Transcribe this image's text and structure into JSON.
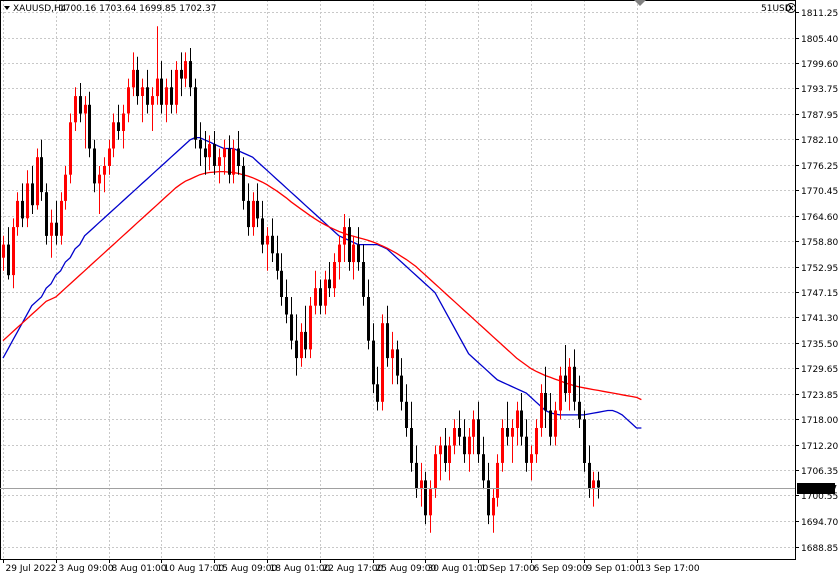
{
  "header": {
    "symbol": "XAUUSD,H4",
    "ohlc": "1700.16 1703.64 1699.85 1702.37",
    "account_label": "51USD"
  },
  "colors": {
    "background": "#ffffff",
    "grid": "#c8c8c8",
    "bull_candle": "#ff0000",
    "bear_candle": "#000000",
    "ma_fast": "#0000cc",
    "ma_slow": "#ff0000",
    "price_tag_bg": "#000000",
    "price_tag_text": "#ffffff"
  },
  "chart_data": {
    "type": "candlestick",
    "symbol": "XAUUSD",
    "timeframe": "H4",
    "current_price": 1702.37,
    "current_price_label": "1702.37",
    "y_ticks": [
      "1811.25",
      "1805.40",
      "1799.60",
      "1793.75",
      "1787.95",
      "1782.10",
      "1776.25",
      "1770.45",
      "1764.60",
      "1758.80",
      "1752.95",
      "1747.15",
      "1741.30",
      "1735.50",
      "1729.65",
      "1723.85",
      "1718.00",
      "1712.20",
      "1706.35",
      "1700.55",
      "1694.70",
      "1688.85"
    ],
    "ylim": [
      1686.0,
      1814.0
    ],
    "x_ticks": [
      {
        "label": "29 Jul 2022",
        "index": 0
      },
      {
        "label": "3 Aug 09:00",
        "index": 11
      },
      {
        "label": "8 Aug 01:00",
        "index": 22
      },
      {
        "label": "10 Aug 17:00",
        "index": 33
      },
      {
        "label": "15 Aug 09:00",
        "index": 44
      },
      {
        "label": "18 Aug 01:00",
        "index": 55
      },
      {
        "label": "22 Aug 17:00",
        "index": 66
      },
      {
        "label": "25 Aug 09:00",
        "index": 77
      },
      {
        "label": "30 Aug 01:00",
        "index": 88
      },
      {
        "label": "1 Sep 17:00",
        "index": 99
      },
      {
        "label": "6 Sep 09:00",
        "index": 110
      },
      {
        "label": "9 Sep 01:00",
        "index": 121
      },
      {
        "label": "13 Sep 17:00",
        "index": 132
      }
    ],
    "series": [
      {
        "name": "",
        "color": "#0000cc",
        "values": [
          1732,
          1734,
          1736,
          1738,
          1740,
          1742,
          1744,
          1745,
          1746,
          1748,
          1749,
          1751,
          1752,
          1754,
          1755,
          1757,
          1758,
          1760,
          1761,
          1762,
          1763,
          1764,
          1765,
          1766,
          1767,
          1768,
          1769,
          1770,
          1771,
          1772,
          1773,
          1774,
          1775,
          1776,
          1777,
          1778,
          1779,
          1780,
          1781,
          1782,
          1782.5,
          1782.5,
          1782,
          1781.5,
          1781,
          1780.5,
          1780,
          1780,
          1780,
          1779.5,
          1779,
          1778.5,
          1778,
          1777,
          1776,
          1775,
          1774,
          1773,
          1772,
          1771,
          1770,
          1769,
          1768,
          1767,
          1766,
          1765,
          1764,
          1763,
          1762,
          1761,
          1760,
          1759.5,
          1759,
          1758.5,
          1758,
          1758,
          1758,
          1758,
          1758,
          1757.5,
          1757,
          1756,
          1755,
          1754,
          1753,
          1752,
          1751,
          1750,
          1749,
          1748,
          1747,
          1745,
          1743,
          1741,
          1739,
          1737,
          1735,
          1733,
          1732,
          1731,
          1730,
          1729,
          1728,
          1727,
          1726.5,
          1726,
          1725.5,
          1725,
          1724.5,
          1724,
          1723,
          1722,
          1721,
          1720,
          1719.5,
          1719.2,
          1719,
          1719,
          1719,
          1719,
          1719,
          1719,
          1719.2,
          1719.4,
          1719.6,
          1719.8,
          1720,
          1720,
          1719.6,
          1719,
          1718,
          1717,
          1716,
          1716
        ]
      },
      {
        "name": "",
        "color": "#ff0000",
        "values": [
          1736,
          1737,
          1738,
          1739,
          1740,
          1741,
          1742,
          1743,
          1744,
          1745,
          1745.5,
          1746,
          1747,
          1748,
          1749,
          1750,
          1751,
          1752,
          1753,
          1754,
          1755,
          1756,
          1757,
          1758,
          1759,
          1760,
          1761,
          1762,
          1763,
          1764,
          1765,
          1766,
          1767,
          1768,
          1769,
          1770,
          1771,
          1771.8,
          1772.5,
          1773,
          1773.5,
          1774,
          1774.3,
          1774.5,
          1774.6,
          1774.7,
          1774.7,
          1774.6,
          1774.5,
          1774.3,
          1774,
          1773.7,
          1773.3,
          1772.8,
          1772.3,
          1771.7,
          1771,
          1770.3,
          1769.5,
          1768.7,
          1767.8,
          1767,
          1766.2,
          1765.4,
          1764.6,
          1763.9,
          1763.2,
          1762.6,
          1762,
          1761.5,
          1761,
          1760.6,
          1760.2,
          1759.9,
          1759.6,
          1759.3,
          1759,
          1758.6,
          1758.2,
          1757.7,
          1757.2,
          1756.6,
          1756,
          1755.3,
          1754.6,
          1753.8,
          1753,
          1752,
          1751,
          1750,
          1749,
          1748,
          1747,
          1746,
          1745,
          1744,
          1743,
          1742,
          1741,
          1740,
          1739,
          1738,
          1737,
          1736,
          1735,
          1734,
          1733,
          1732,
          1731.2,
          1730.4,
          1729.6,
          1729,
          1728.5,
          1728,
          1727.6,
          1727.2,
          1726.8,
          1726.4,
          1726,
          1725.7,
          1725.4,
          1725.2,
          1725,
          1724.8,
          1724.6,
          1724.4,
          1724.2,
          1724,
          1723.8,
          1723.6,
          1723.4,
          1723.2,
          1723,
          1722.5
        ]
      }
    ],
    "candles": [
      [
        1755,
        1760,
        1752,
        1758
      ],
      [
        1758,
        1762,
        1750,
        1751
      ],
      [
        1751,
        1764,
        1748,
        1762
      ],
      [
        1762,
        1770,
        1760,
        1768
      ],
      [
        1768,
        1772,
        1762,
        1764
      ],
      [
        1764,
        1775,
        1762,
        1772
      ],
      [
        1772,
        1776,
        1765,
        1767
      ],
      [
        1767,
        1780,
        1766,
        1778
      ],
      [
        1778,
        1782,
        1768,
        1770
      ],
      [
        1770,
        1772,
        1758,
        1760
      ],
      [
        1760,
        1766,
        1755,
        1763
      ],
      [
        1763,
        1768,
        1758,
        1760
      ],
      [
        1760,
        1770,
        1758,
        1768
      ],
      [
        1768,
        1776,
        1766,
        1774
      ],
      [
        1774,
        1788,
        1772,
        1786
      ],
      [
        1786,
        1794,
        1784,
        1792
      ],
      [
        1792,
        1795,
        1786,
        1788
      ],
      [
        1788,
        1792,
        1780,
        1790
      ],
      [
        1790,
        1793,
        1778,
        1780
      ],
      [
        1780,
        1782,
        1770,
        1772
      ],
      [
        1772,
        1776,
        1765,
        1774
      ],
      [
        1774,
        1778,
        1770,
        1776
      ],
      [
        1776,
        1782,
        1774,
        1780
      ],
      [
        1780,
        1788,
        1778,
        1786
      ],
      [
        1786,
        1790,
        1782,
        1784
      ],
      [
        1784,
        1790,
        1780,
        1788
      ],
      [
        1788,
        1796,
        1786,
        1794
      ],
      [
        1794,
        1802,
        1792,
        1798
      ],
      [
        1798,
        1801,
        1790,
        1792
      ],
      [
        1792,
        1796,
        1786,
        1794
      ],
      [
        1794,
        1798,
        1788,
        1790
      ],
      [
        1790,
        1794,
        1784,
        1792
      ],
      [
        1792,
        1808,
        1790,
        1796
      ],
      [
        1796,
        1800,
        1788,
        1790
      ],
      [
        1790,
        1796,
        1786,
        1794
      ],
      [
        1794,
        1798,
        1788,
        1790
      ],
      [
        1790,
        1800,
        1788,
        1798
      ],
      [
        1798,
        1802,
        1792,
        1796
      ],
      [
        1796,
        1802,
        1794,
        1800
      ],
      [
        1800,
        1803,
        1792,
        1794
      ],
      [
        1794,
        1796,
        1780,
        1782
      ],
      [
        1782,
        1786,
        1776,
        1780
      ],
      [
        1780,
        1784,
        1774,
        1778
      ],
      [
        1778,
        1783,
        1775,
        1781
      ],
      [
        1781,
        1784,
        1774,
        1776
      ],
      [
        1776,
        1780,
        1772,
        1778
      ],
      [
        1778,
        1782,
        1774,
        1780
      ],
      [
        1780,
        1783,
        1772,
        1774
      ],
      [
        1774,
        1782,
        1772,
        1780
      ],
      [
        1780,
        1784,
        1774,
        1776
      ],
      [
        1776,
        1778,
        1766,
        1768
      ],
      [
        1768,
        1772,
        1760,
        1762
      ],
      [
        1762,
        1770,
        1760,
        1768
      ],
      [
        1768,
        1772,
        1762,
        1764
      ],
      [
        1764,
        1768,
        1756,
        1758
      ],
      [
        1758,
        1762,
        1752,
        1760
      ],
      [
        1760,
        1764,
        1754,
        1756
      ],
      [
        1756,
        1760,
        1750,
        1752
      ],
      [
        1752,
        1756,
        1744,
        1746
      ],
      [
        1746,
        1750,
        1740,
        1742
      ],
      [
        1742,
        1746,
        1734,
        1736
      ],
      [
        1736,
        1742,
        1728,
        1732
      ],
      [
        1732,
        1740,
        1730,
        1738
      ],
      [
        1738,
        1744,
        1732,
        1734
      ],
      [
        1734,
        1746,
        1732,
        1744
      ],
      [
        1744,
        1752,
        1742,
        1748
      ],
      [
        1748,
        1750,
        1742,
        1744
      ],
      [
        1744,
        1752,
        1742,
        1750
      ],
      [
        1750,
        1754,
        1746,
        1748
      ],
      [
        1748,
        1756,
        1746,
        1754
      ],
      [
        1754,
        1760,
        1750,
        1758
      ],
      [
        1758,
        1765,
        1754,
        1762
      ],
      [
        1762,
        1764,
        1752,
        1754
      ],
      [
        1754,
        1760,
        1750,
        1758
      ],
      [
        1758,
        1762,
        1752,
        1754
      ],
      [
        1754,
        1758,
        1744,
        1746
      ],
      [
        1746,
        1750,
        1734,
        1736
      ],
      [
        1736,
        1740,
        1724,
        1726
      ],
      [
        1726,
        1730,
        1720,
        1722
      ],
      [
        1722,
        1742,
        1720,
        1740
      ],
      [
        1740,
        1744,
        1730,
        1732
      ],
      [
        1732,
        1738,
        1726,
        1734
      ],
      [
        1734,
        1736,
        1726,
        1728
      ],
      [
        1728,
        1732,
        1720,
        1722
      ],
      [
        1722,
        1726,
        1714,
        1716
      ],
      [
        1716,
        1722,
        1706,
        1708
      ],
      [
        1708,
        1712,
        1700,
        1702
      ],
      [
        1702,
        1708,
        1698,
        1704
      ],
      [
        1704,
        1706,
        1694,
        1696
      ],
      [
        1696,
        1704,
        1692,
        1702
      ],
      [
        1702,
        1712,
        1700,
        1710
      ],
      [
        1710,
        1714,
        1704,
        1712
      ],
      [
        1712,
        1716,
        1706,
        1708
      ],
      [
        1708,
        1714,
        1704,
        1712
      ],
      [
        1712,
        1718,
        1710,
        1716
      ],
      [
        1716,
        1720,
        1712,
        1714
      ],
      [
        1714,
        1718,
        1708,
        1710
      ],
      [
        1710,
        1716,
        1706,
        1714
      ],
      [
        1714,
        1720,
        1710,
        1718
      ],
      [
        1718,
        1722,
        1708,
        1710
      ],
      [
        1710,
        1714,
        1702,
        1704
      ],
      [
        1704,
        1708,
        1694,
        1696
      ],
      [
        1696,
        1702,
        1692,
        1700
      ],
      [
        1700,
        1710,
        1698,
        1708
      ],
      [
        1708,
        1718,
        1706,
        1716
      ],
      [
        1716,
        1722,
        1712,
        1714
      ],
      [
        1714,
        1718,
        1708,
        1716
      ],
      [
        1716,
        1722,
        1712,
        1720
      ],
      [
        1720,
        1724,
        1712,
        1714
      ],
      [
        1714,
        1718,
        1706,
        1708
      ],
      [
        1708,
        1712,
        1704,
        1710
      ],
      [
        1710,
        1718,
        1708,
        1716
      ],
      [
        1716,
        1726,
        1714,
        1724
      ],
      [
        1724,
        1730,
        1716,
        1720
      ],
      [
        1720,
        1724,
        1712,
        1714
      ],
      [
        1714,
        1722,
        1712,
        1720
      ],
      [
        1720,
        1730,
        1718,
        1728
      ],
      [
        1728,
        1735,
        1722,
        1724
      ],
      [
        1724,
        1732,
        1720,
        1730
      ],
      [
        1730,
        1734,
        1720,
        1722
      ],
      [
        1722,
        1728,
        1716,
        1718
      ],
      [
        1718,
        1720,
        1706,
        1708
      ],
      [
        1708,
        1712,
        1700,
        1702
      ],
      [
        1702,
        1706,
        1698,
        1704
      ],
      [
        1704,
        1706,
        1699.85,
        1702.37
      ]
    ]
  }
}
